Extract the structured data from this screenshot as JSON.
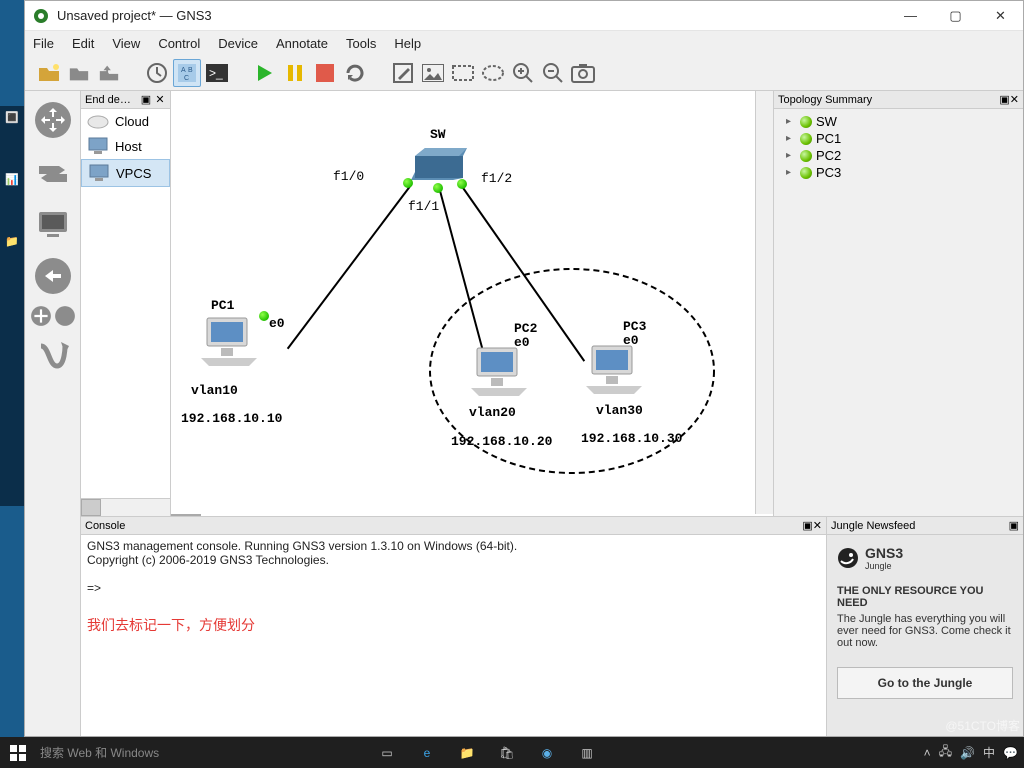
{
  "window": {
    "title": "Unsaved project* — GNS3",
    "menu": [
      "File",
      "Edit",
      "View",
      "Control",
      "Device",
      "Annotate",
      "Tools",
      "Help"
    ]
  },
  "palette": {
    "title": "End de…",
    "items": [
      {
        "label": "Cloud",
        "icon": "cloud"
      },
      {
        "label": "Host",
        "icon": "monitor"
      },
      {
        "label": "VPCS",
        "icon": "monitor"
      }
    ],
    "selected": 2
  },
  "topology_panel": {
    "title": "Topology Summary",
    "nodes": [
      "SW",
      "PC1",
      "PC2",
      "PC3"
    ]
  },
  "console": {
    "title": "Console",
    "line1": "GNS3 management console. Running GNS3 version 1.3.10 on Windows (64-bit).",
    "line2": "Copyright (c) 2006-2019 GNS3 Technologies.",
    "prompt": "=>",
    "annotation": "我们去标记一下，方便划分"
  },
  "newsfeed": {
    "title": "Jungle Newsfeed",
    "brand": "GNS3",
    "brand_sub": "Jungle",
    "headline": "THE ONLY RESOURCE YOU NEED",
    "body": "The Jungle has everything you will ever need for GNS3. Come check it out now.",
    "button": "Go to the Jungle"
  },
  "canvas": {
    "sw_label": "SW",
    "ports": {
      "f10": "f1/0",
      "f11": "f1/1",
      "f12": "f1/2"
    },
    "pc1": {
      "name": "PC1",
      "iface": "e0",
      "vlan": "vlan10",
      "ip": "192.168.10.10"
    },
    "pc2": {
      "name": "PC2",
      "iface": "e0",
      "vlan": "vlan20",
      "ip": "192.168.10.20"
    },
    "pc3": {
      "name": "PC3",
      "iface": "e0",
      "vlan": "vlan30",
      "ip": "192.168.10.30"
    }
  },
  "taskbar": {
    "search": "搜索 Web 和 Windows"
  },
  "watermark": "@51CTO博客"
}
